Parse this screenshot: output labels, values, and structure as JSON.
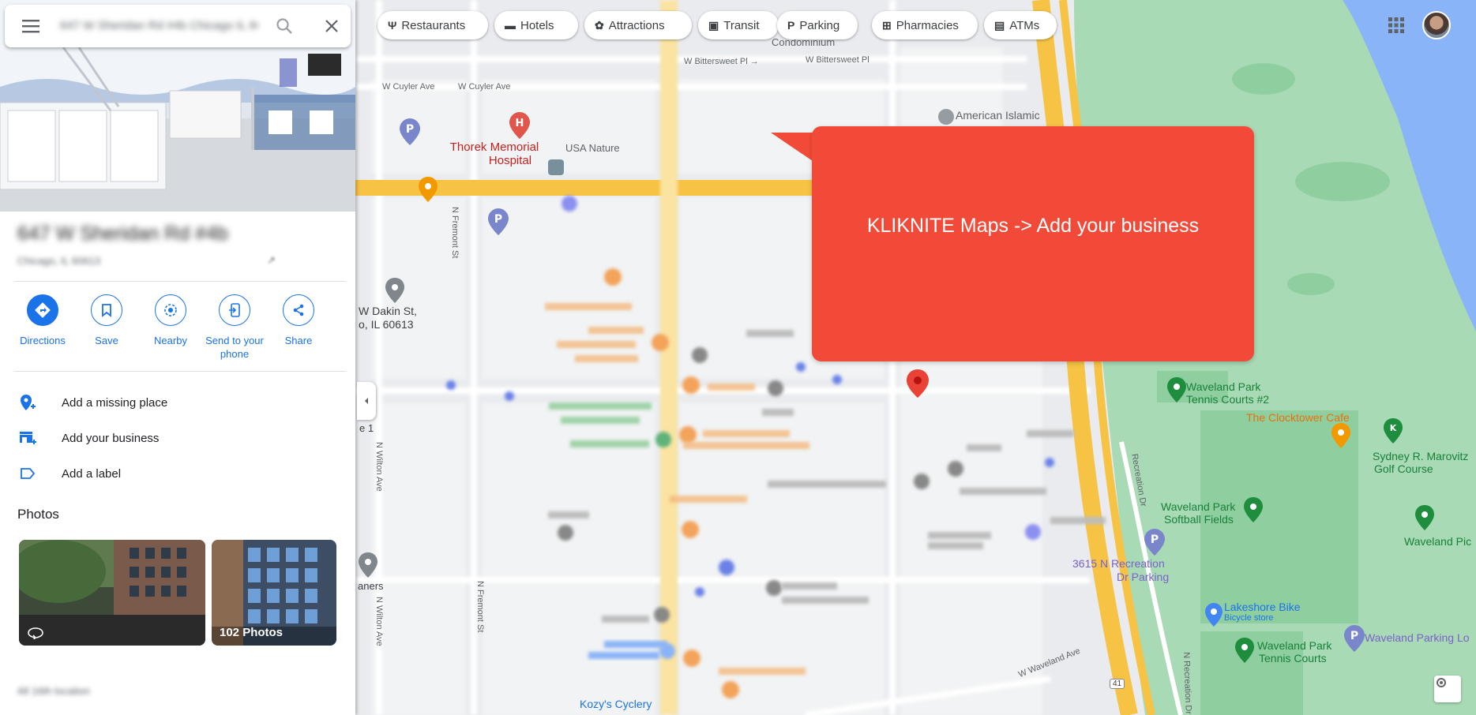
{
  "search": {
    "value": "647 W Sheridan Rd #4b Chicago IL 60613"
  },
  "place": {
    "title": "647 W Sheridan Rd #4b",
    "subtitle": "Chicago, IL 60613",
    "mark": "↗"
  },
  "actions": [
    {
      "label": "Directions",
      "icon": "directions-icon"
    },
    {
      "label": "Save",
      "icon": "bookmark-icon"
    },
    {
      "label": "Nearby",
      "icon": "nearby-icon"
    },
    {
      "label": "Send to your phone",
      "icon": "send-to-phone-icon"
    },
    {
      "label": "Share",
      "icon": "share-icon"
    }
  ],
  "menu": [
    {
      "label": "Add a missing place",
      "icon": "add-location-icon"
    },
    {
      "label": "Add your business",
      "icon": "add-business-icon"
    },
    {
      "label": "Add a label",
      "icon": "label-icon"
    }
  ],
  "photos": {
    "heading": "Photos",
    "count_label": "102 Photos"
  },
  "footer_blur": "All 16th location",
  "chips": [
    {
      "label": "Restaurants",
      "icon": "restaurant-icon"
    },
    {
      "label": "Hotels",
      "icon": "hotel-icon"
    },
    {
      "label": "Attractions",
      "icon": "attractions-icon"
    },
    {
      "label": "Transit",
      "icon": "transit-icon"
    },
    {
      "label": "Parking",
      "icon": "parking-icon"
    },
    {
      "label": "Pharmacies",
      "icon": "pharmacy-icon"
    },
    {
      "label": "ATMs",
      "icon": "atm-icon"
    }
  ],
  "callout": {
    "text": "KLIKNITE Maps -> Add your business",
    "color": "#f24a38"
  },
  "map_labels": {
    "w_cuyler_ave_1": "W Cuyler Ave",
    "w_cuyler_ave_2": "W Cuyler Ave",
    "w_bittersweet_1": "W Bittersweet Pl →",
    "w_bittersweet_2": "W Bittersweet Pl",
    "condominium": "Condominium",
    "american_islamic": "American Islamic",
    "thorek_1": "Thorek Memorial",
    "thorek_2": "Hospital",
    "usa_nature": "USA Nature",
    "dakin_1": "W Dakin St,",
    "dakin_2": "o, IL 60613",
    "n_fremont": "N Fremont St",
    "n_wilton": "N Wilton Ave",
    "n_wilton_2": "N Wilton Ave",
    "n_fremont_2": "N Fremont St",
    "e1": "e 1",
    "aners": "aners",
    "waveland_tennis_2_a": "Waveland Park",
    "waveland_tennis_2_b": "Tennis Courts #2",
    "clocktower": "The Clocktower Cafe",
    "sydney_1": "Sydney R. Marovitz",
    "sydney_2": "Golf Course",
    "waveland_softball_1": "Waveland Park",
    "waveland_softball_2": "Softball Fields",
    "waveland_pic": "Waveland Pic",
    "recreation_parking_1": "3615 N Recreation",
    "recreation_parking_2": "Dr Parking",
    "lakeshore_bike_1": "Lakeshore Bike",
    "lakeshore_bike_2": "Bicycle store",
    "waveland_tennis_a": "Waveland Park",
    "waveland_tennis_b": "Tennis Courts",
    "waveland_parking": "Waveland Parking Lo",
    "w_waveland_ave": "W Waveland Ave",
    "kozys_1": "Kozy's Cyclery",
    "route_41": "41",
    "recreation_dr": "Recreation Dr",
    "n_recreation": "N Recreation Dr"
  },
  "colors": {
    "accent": "#1a73e8",
    "park": "#a8dab5",
    "water": "#8ab4f8",
    "highway": "#f6c344"
  }
}
